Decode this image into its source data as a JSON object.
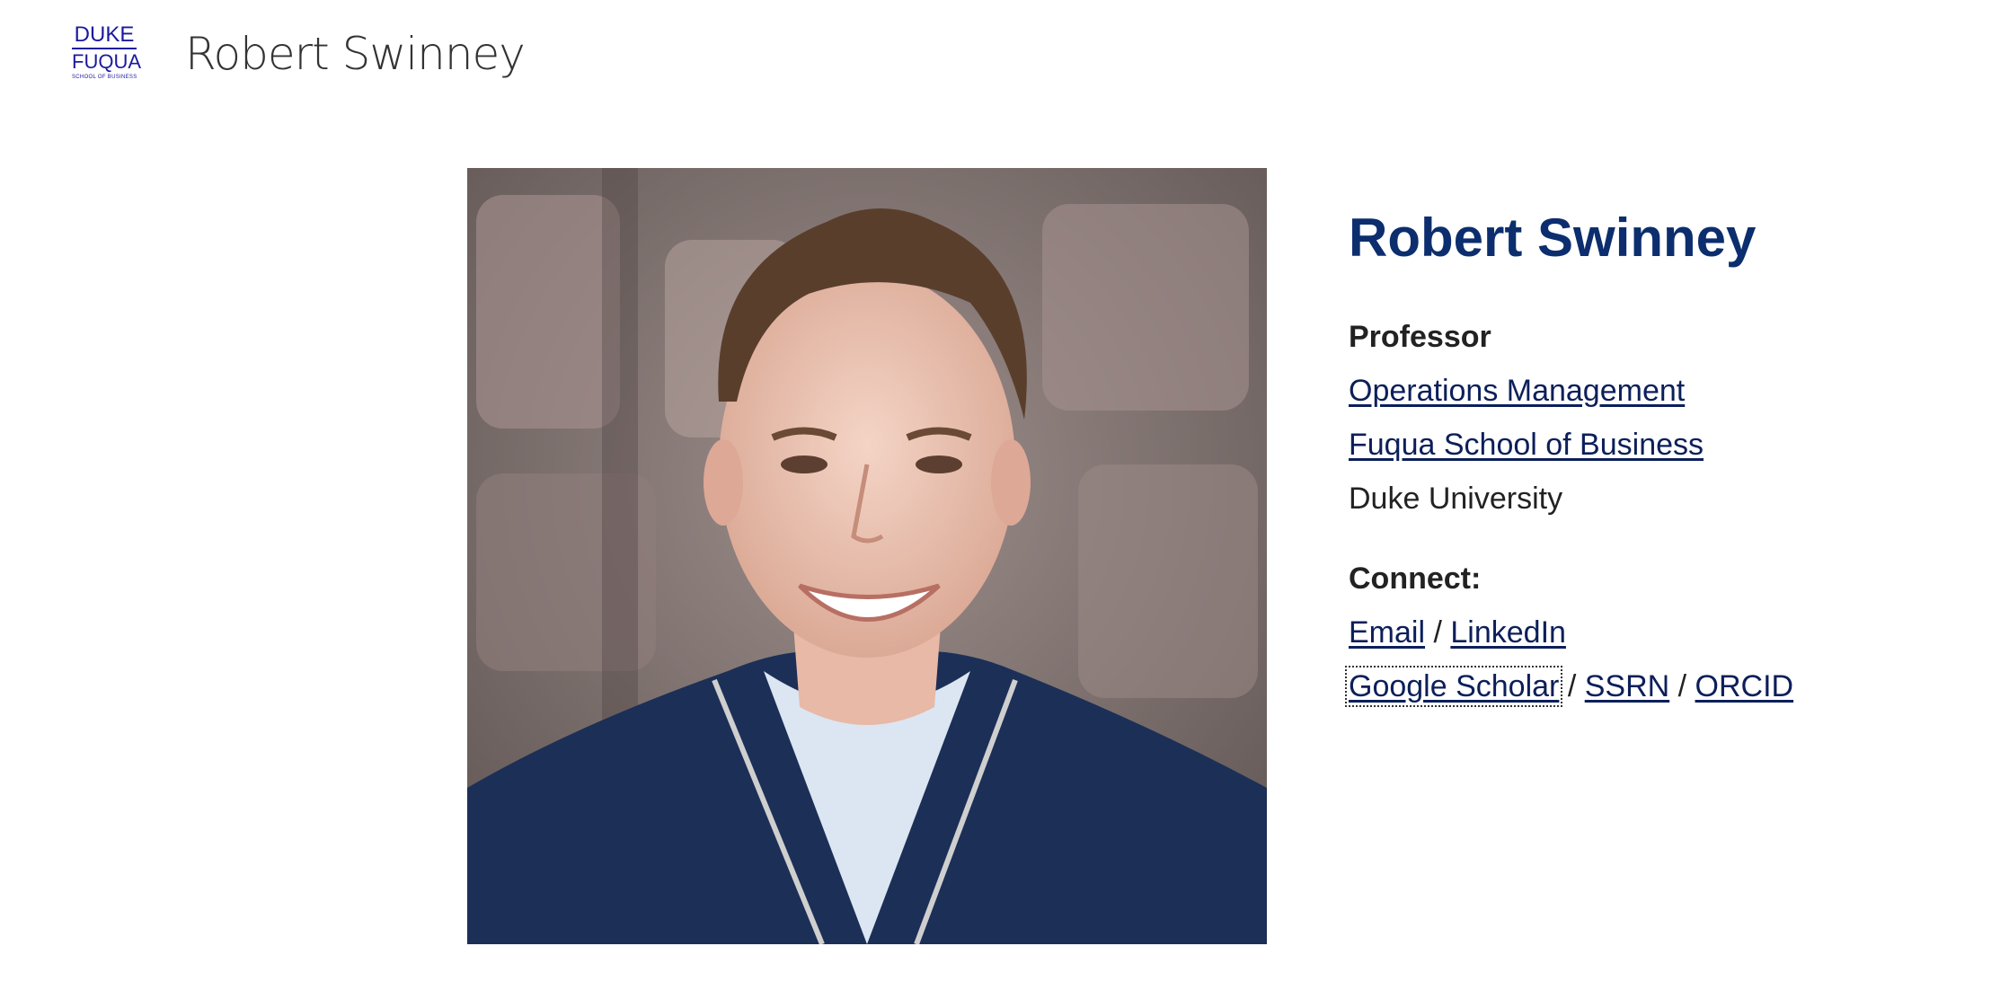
{
  "header": {
    "logo": {
      "line1": "DUKE",
      "line2": "FUQUA",
      "line3": "SCHOOL OF BUSINESS",
      "color": "#1a1a9e"
    },
    "site_title": "Robert Swinney"
  },
  "profile": {
    "photo_alt": "Robert Swinney",
    "name": "Robert Swinney",
    "name_color": "#0c2e6e",
    "title": "Professor",
    "department": "Operations Management",
    "school": "Fuqua School of Business",
    "university": "Duke University",
    "connect_label": "Connect:",
    "links_row1": {
      "email": "Email",
      "sep": " / ",
      "linkedin": "LinkedIn"
    },
    "links_row2": {
      "google_scholar": "Google Scholar",
      "sep1": " / ",
      "ssrn": "SSRN",
      "sep2": " / ",
      "orcid": "ORCID"
    },
    "link_color": "#0c1f5a"
  }
}
